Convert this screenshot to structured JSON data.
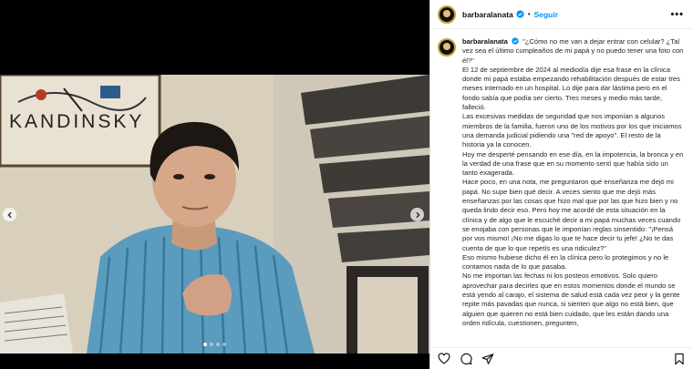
{
  "post": {
    "username": "barbaralanata",
    "separator": "•",
    "follow_label": "Seguir",
    "more_label": "•••",
    "caption_user": "barbaralanata",
    "caption_paragraphs": [
      "\"¿Cómo no me van a dejar entrar con celular? ¿Tal vez sea el último cumpleaños de mi papá y no puedo tener una foto con él?\"",
      "El 12 de septiembre de 2024 al mediodía dije esa frase en la clínica donde mi papá estaba empezando rehabilitación después de estar tres meses internado en un hospital. Lo dije para dar lástima pero en el fondo sabía que podía ser cierto. Tres meses y medio más tarde, falleció.",
      "Las excesivas medidas de seguridad que nos imponían a algunos miembros de la familia, fueron uno de los motivos por los que iniciamos una demanda judicial pidiendo una \"red de apoyo\". El resto de la historia ya la conocen.",
      "Hoy me desperté pensando en ese día, en la impotencia, la bronca y en la verdad de una frase que en su momento sentí que había sido un tanto exagerada.",
      "Hace poco, en una nota, me preguntaron qué enseñanza me dejó mi papá. No supe bien qué decir. A veces siento que me dejó más enseñanzas por las cosas que hizo mal que por las que hizo bien y no queda lindo decir eso. Pero hoy me acordé de esta situación en la clínica y de algo que le escuché decir a mi papá muchas veces cuando se enojaba con personas que le imponían reglas sinsentido: \"¡Pensá por vos mismo! ¡No me digas lo que te hace decir tu jefe! ¿No te das cuenta de que lo que repetís es una ridiculez?\"",
      "Eso mismo hubiese dicho él en la clínica pero lo protegimos y no le contamos nada de lo que pasaba.",
      "No me importan las fechas ni los posteos emotivos. Solo quiero aprovechar para decirles que en estos momentos donde el mundo se está yendo al carajo, el sistema de salud está cada vez peor y la gente repite más pavadas que nunca, si sienten que algo no está bien, que alguien que quieren no está bien cuidado, que les están dando una orden ridícula, cuestionen, pregunten,"
    ]
  },
  "media": {
    "photo_sign_text": "KANDINSKY",
    "carousel_total": 4,
    "carousel_active": 0
  },
  "icons": {
    "verified": "verified-badge-icon",
    "prev": "chevron-left-icon",
    "next": "chevron-right-icon",
    "like": "heart-icon",
    "comment": "comment-icon",
    "share": "share-icon",
    "save": "bookmark-icon"
  },
  "colors": {
    "follow": "#0095f6",
    "verified": "#0095f6",
    "avatar_ring": "#c9a43a"
  }
}
